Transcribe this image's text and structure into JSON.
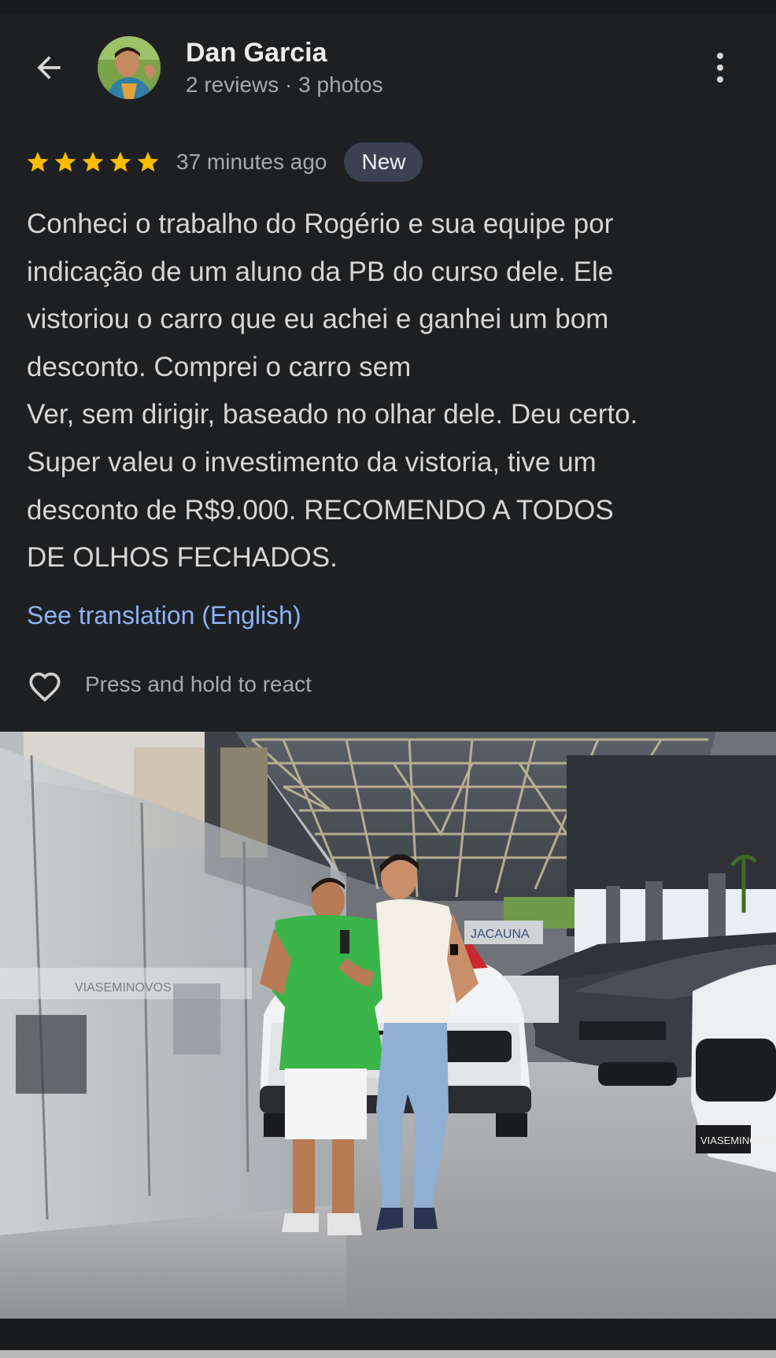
{
  "reviewer": {
    "name": "Dan Garcia",
    "reviews": "2 reviews",
    "separator": "·",
    "photos": "3 photos"
  },
  "review": {
    "rating": 5,
    "time": "37 minutes ago",
    "badge": "New",
    "lines": [
      "Conheci o trabalho do Rogério e sua equipe por",
      "indicação de um aluno da PB do curso dele. Ele",
      "vistoriou o carro que eu achei e ganhei um bom",
      "desconto. Comprei o carro sem",
      "Ver, sem dirigir, baseado no olhar dele. Deu certo.",
      "Super valeu o investimento da vistoria, tive um",
      "desconto de R$9.000. RECOMENDO A TODOS",
      "DE OLHOS FECHADOS."
    ],
    "translate_link": "See translation (English)",
    "react_hint": "Press and hold to react"
  },
  "photo": {
    "sign_text": "JACAUNA",
    "glass_text": "VIASEMINOVOS",
    "plate_text": "VIASEMINOVOS"
  },
  "colors": {
    "background": "#1e1f21",
    "star": "#fbbc04",
    "link": "#8ab4f8",
    "badge": "#3b4150"
  },
  "icons": {
    "back": "arrow-back-icon",
    "more": "more-vert-icon",
    "star": "star-icon",
    "react": "heart-outline-icon"
  }
}
